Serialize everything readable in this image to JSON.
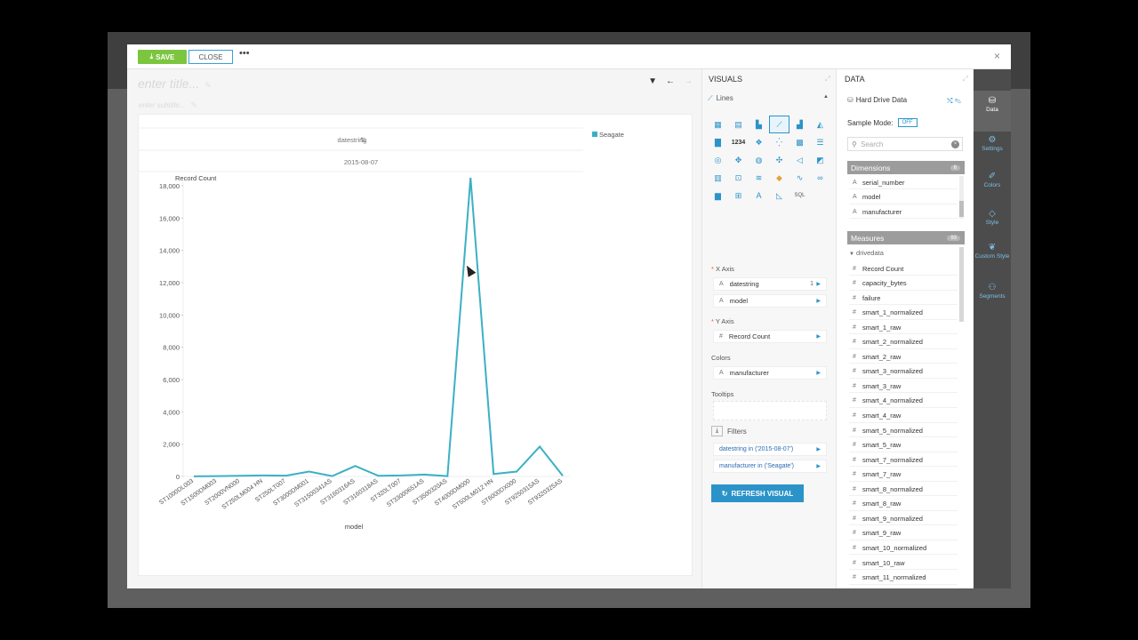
{
  "toolbar": {
    "save_label": "SAVE",
    "close_label": "CLOSE",
    "more_label": "•••",
    "modal_close": "×"
  },
  "canvas": {
    "title_placeholder": "enter title...",
    "subtitle_placeholder": "enter subtitle...",
    "tool_icons": [
      "filter-icon",
      "undo-icon",
      "redo-icon"
    ]
  },
  "chart_data": {
    "type": "line",
    "column_header": "datestring",
    "column_value": "2015-08-07",
    "legend": [
      {
        "name": "Seagate",
        "color": "#3bb0c4"
      }
    ],
    "ylabel": "Record Count",
    "xlabel": "model",
    "ylim": [
      0,
      18000
    ],
    "y_ticks": [
      "0",
      "2,000",
      "4,000",
      "6,000",
      "8,000",
      "10,000",
      "12,000",
      "14,000",
      "16,000",
      "18,000"
    ],
    "categories": [
      "ST1000DL003",
      "ST1500DM003",
      "ST2000VN000",
      "ST250LM004 HN",
      "ST250LT007",
      "ST3000DM001",
      "ST31500341AS",
      "ST3160316AS",
      "ST3160318AS",
      "ST320LT007",
      "ST33000651AS",
      "ST3500320AS",
      "ST4000DM000",
      "ST500LM012 HN",
      "ST6000DX000",
      "ST9250315AS",
      "ST9320325AS"
    ],
    "series": [
      {
        "name": "Seagate",
        "values": [
          10,
          20,
          40,
          60,
          50,
          300,
          20,
          650,
          40,
          60,
          120,
          20,
          18500,
          150,
          300,
          1850,
          40
        ]
      }
    ]
  },
  "visuals": {
    "header": "VISUALS",
    "chart_type": "Lines",
    "x_axis_label": "X Axis",
    "x_axis": [
      {
        "type": "A",
        "field": "datestring",
        "extra": "1"
      },
      {
        "type": "A",
        "field": "model",
        "extra": ""
      }
    ],
    "y_axis_label": "Y Axis",
    "y_axis": [
      {
        "type": "#",
        "field": "Record Count"
      }
    ],
    "colors_label": "Colors",
    "colors": [
      {
        "type": "A",
        "field": "manufacturer"
      }
    ],
    "tooltips_label": "Tooltips",
    "filters_label": "Filters",
    "filters": [
      "datestring in ('2015-08-07')",
      "manufacturer in ('Seagate')"
    ],
    "refresh_label": "REFRESH VISUAL"
  },
  "data": {
    "header": "DATA",
    "dataset": "Hard Drive Data",
    "sample_mode_label": "Sample Mode:",
    "sample_mode_value": "OFF",
    "search_placeholder": "Search",
    "dimensions_label": "Dimensions",
    "dimensions_count": "6",
    "dimensions": [
      "serial_number",
      "model",
      "manufacturer"
    ],
    "measures_label": "Measures",
    "measures_count": "93",
    "measures_folder": "drivedata",
    "measures": [
      "Record Count",
      "capacity_bytes",
      "failure",
      "smart_1_normalized",
      "smart_1_raw",
      "smart_2_normalized",
      "smart_2_raw",
      "smart_3_normalized",
      "smart_3_raw",
      "smart_4_normalized",
      "smart_4_raw",
      "smart_5_normalized",
      "smart_5_raw",
      "smart_7_normalized",
      "smart_7_raw",
      "smart_8_normalized",
      "smart_8_raw",
      "smart_9_normalized",
      "smart_9_raw",
      "smart_10_normalized",
      "smart_10_raw",
      "smart_11_normalized"
    ]
  },
  "rail": [
    {
      "label": "Data",
      "icon": "database-icon"
    },
    {
      "label": "Settings",
      "icon": "gears-icon"
    },
    {
      "label": "Colors",
      "icon": "brush-icon"
    },
    {
      "label": "Style",
      "icon": "diamond-icon"
    },
    {
      "label": "Custom Style",
      "icon": "leaf-icon"
    },
    {
      "label": "Segments",
      "icon": "users-icon"
    }
  ]
}
